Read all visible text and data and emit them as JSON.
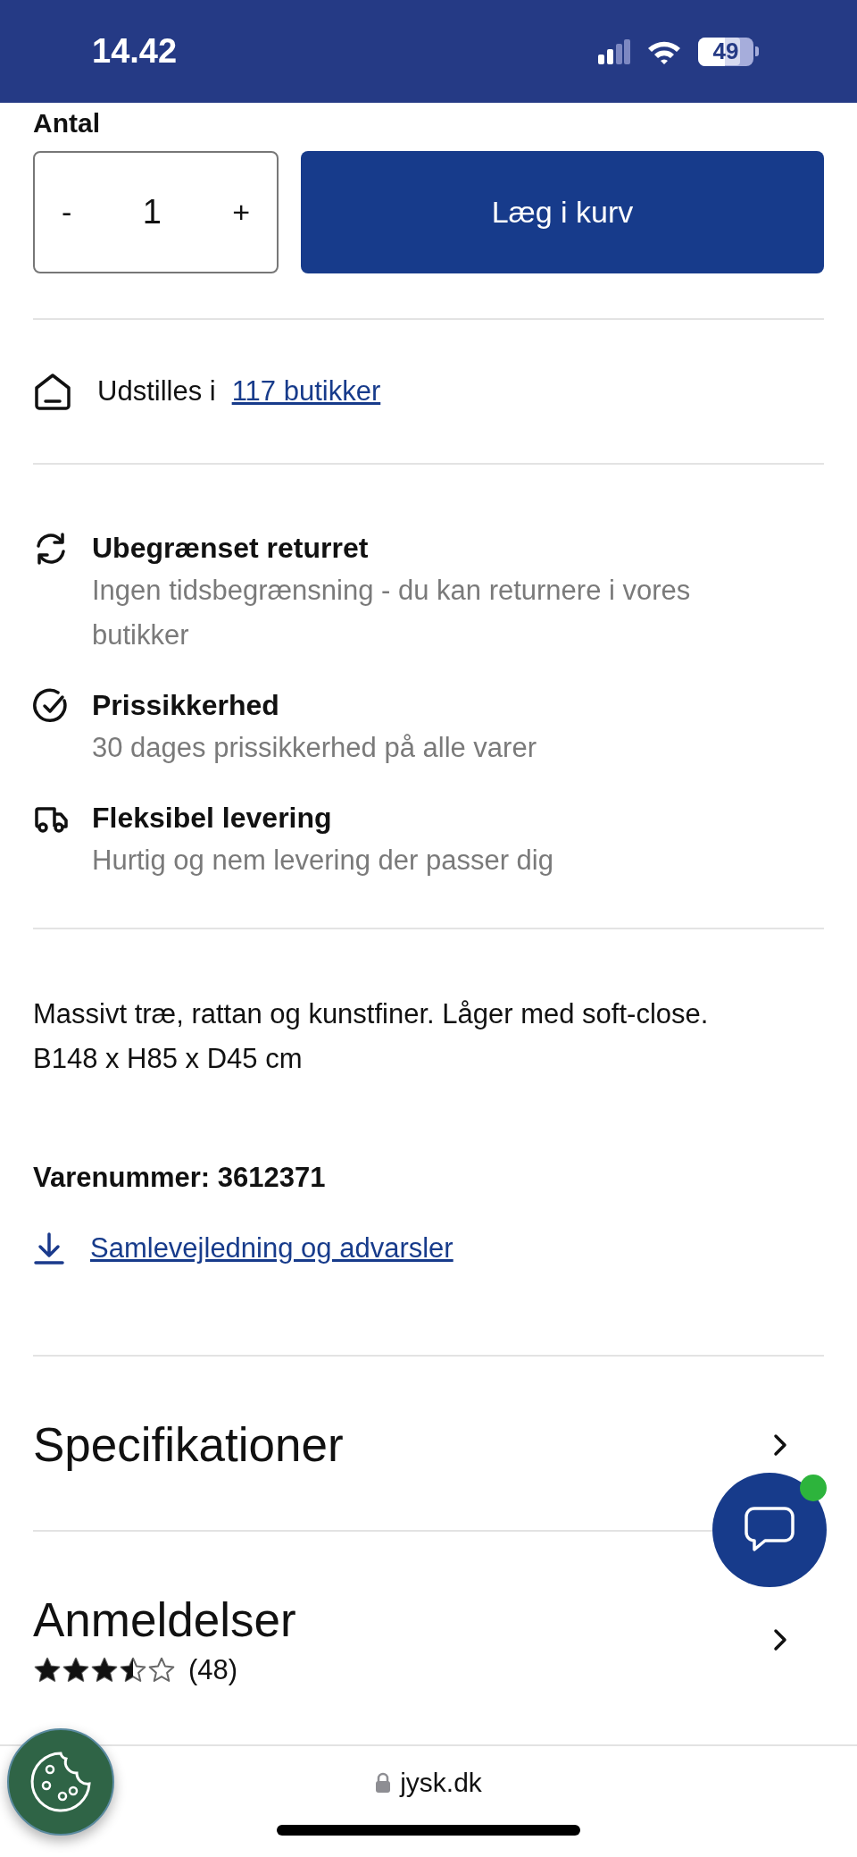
{
  "status_bar": {
    "time": "14.42",
    "battery": "49"
  },
  "quantity": {
    "label": "Antal",
    "decrement": "-",
    "value": "1",
    "increment": "+"
  },
  "add_to_cart": "Læg i kurv",
  "showroom": {
    "text": "Udstilles i",
    "link": "117 butikker"
  },
  "features": [
    {
      "kind": "return",
      "title": "Ubegrænset returret",
      "text": "Ingen tidsbegrænsning - du kan returnere i vores butikker"
    },
    {
      "kind": "price",
      "title": "Prissikkerhed",
      "text": "30 dages prissikkerhed på alle varer"
    },
    {
      "kind": "delivery",
      "title": "Fleksibel levering",
      "text": "Hurtig og nem levering der passer dig"
    }
  ],
  "description": [
    "Massivt træ, rattan og kunstfiner. Låger med soft-close.",
    "B148 x H85 x D45 cm"
  ],
  "item_number": "Varenummer: 3612371",
  "assembly_link": "Samlevejledning og advarsler",
  "sections": [
    {
      "title": "Specifikationer"
    },
    {
      "title": "Anmeldelser",
      "stars": 3.5,
      "count": "(48)"
    }
  ],
  "chat": {
    "unread": true
  },
  "address_bar": {
    "url": "jysk.dk"
  }
}
